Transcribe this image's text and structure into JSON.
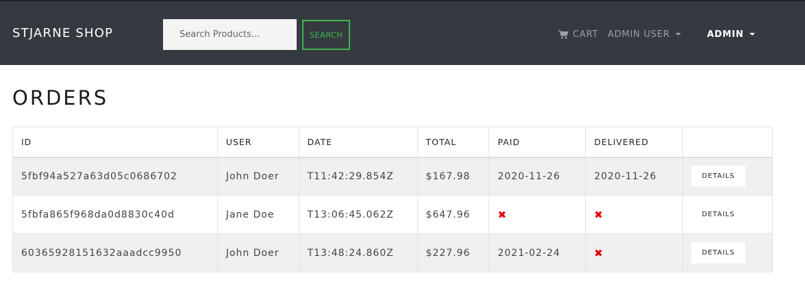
{
  "navbar": {
    "brand": "STJARNE SHOP",
    "search_placeholder": "Search Products...",
    "search_label": "SEARCH",
    "cart_label": "CART",
    "user_menu_label": "ADMIN USER",
    "admin_menu_label": "ADMIN"
  },
  "page": {
    "title": "ORDERS"
  },
  "table": {
    "headers": [
      "ID",
      "USER",
      "DATE",
      "TOTAL",
      "PAID",
      "DELIVERED",
      ""
    ],
    "rows": [
      {
        "id": "5fbf94a527a63d05c0686702",
        "user": "John Doer",
        "date": "T11:42:29.854Z",
        "total": "$167.98",
        "paid": "2020-11-26",
        "delivered": "2020-11-26",
        "details": "DETAILS"
      },
      {
        "id": "5fbfa865f968da0d8830c40d",
        "user": "Jane Doe",
        "date": "T13:06:45.062Z",
        "total": "$647.96",
        "paid": "✖",
        "delivered": "✖",
        "details": "DETAILS"
      },
      {
        "id": "60365928151632aaadcc9950",
        "user": "John Doer",
        "date": "T13:48:24.860Z",
        "total": "$227.96",
        "paid": "2021-02-24",
        "delivered": "✖",
        "details": "DETAILS"
      }
    ]
  },
  "colors": {
    "navbar": "#343a40",
    "accent": "#3fb44f",
    "not_paid": "#e0000f"
  }
}
